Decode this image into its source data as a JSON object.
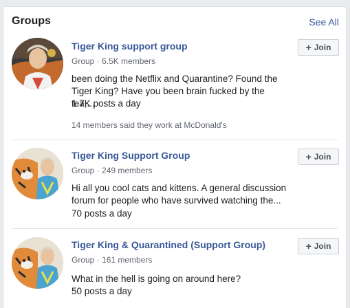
{
  "section": {
    "title": "Groups",
    "see_all": "See All"
  },
  "join_label": "Join",
  "join_icon": "+",
  "groups": [
    {
      "name": "Tiger King support group",
      "meta": "Group · 6.5K members",
      "description": "been doing the Netflix and Quarantine? Found the Tiger King? Have you been brain fucked by the tea,...",
      "posts": "1.7K posts a day",
      "social": "14 members said they work at McDonald's",
      "avatar_icon": "tiger-king-photo"
    },
    {
      "name": "Tiger King Support Group",
      "meta": "Group · 249 members",
      "description": "Hi all you cool cats and kittens. A general discussion forum for people who have survived watching the...",
      "posts": "70 posts a day",
      "avatar_icon": "tiger-king-with-tiger-photo"
    },
    {
      "name": "Tiger King & Quarantined (Support Group)",
      "meta": "Group · 161 members",
      "description": "What in the hell is going on around here?",
      "posts": "50 posts a day",
      "avatar_icon": "tiger-king-with-tiger-photo"
    }
  ],
  "colors": {
    "link": "#385898",
    "meta": "#616770",
    "text": "#1c1e21",
    "background": "#e9ebee"
  }
}
